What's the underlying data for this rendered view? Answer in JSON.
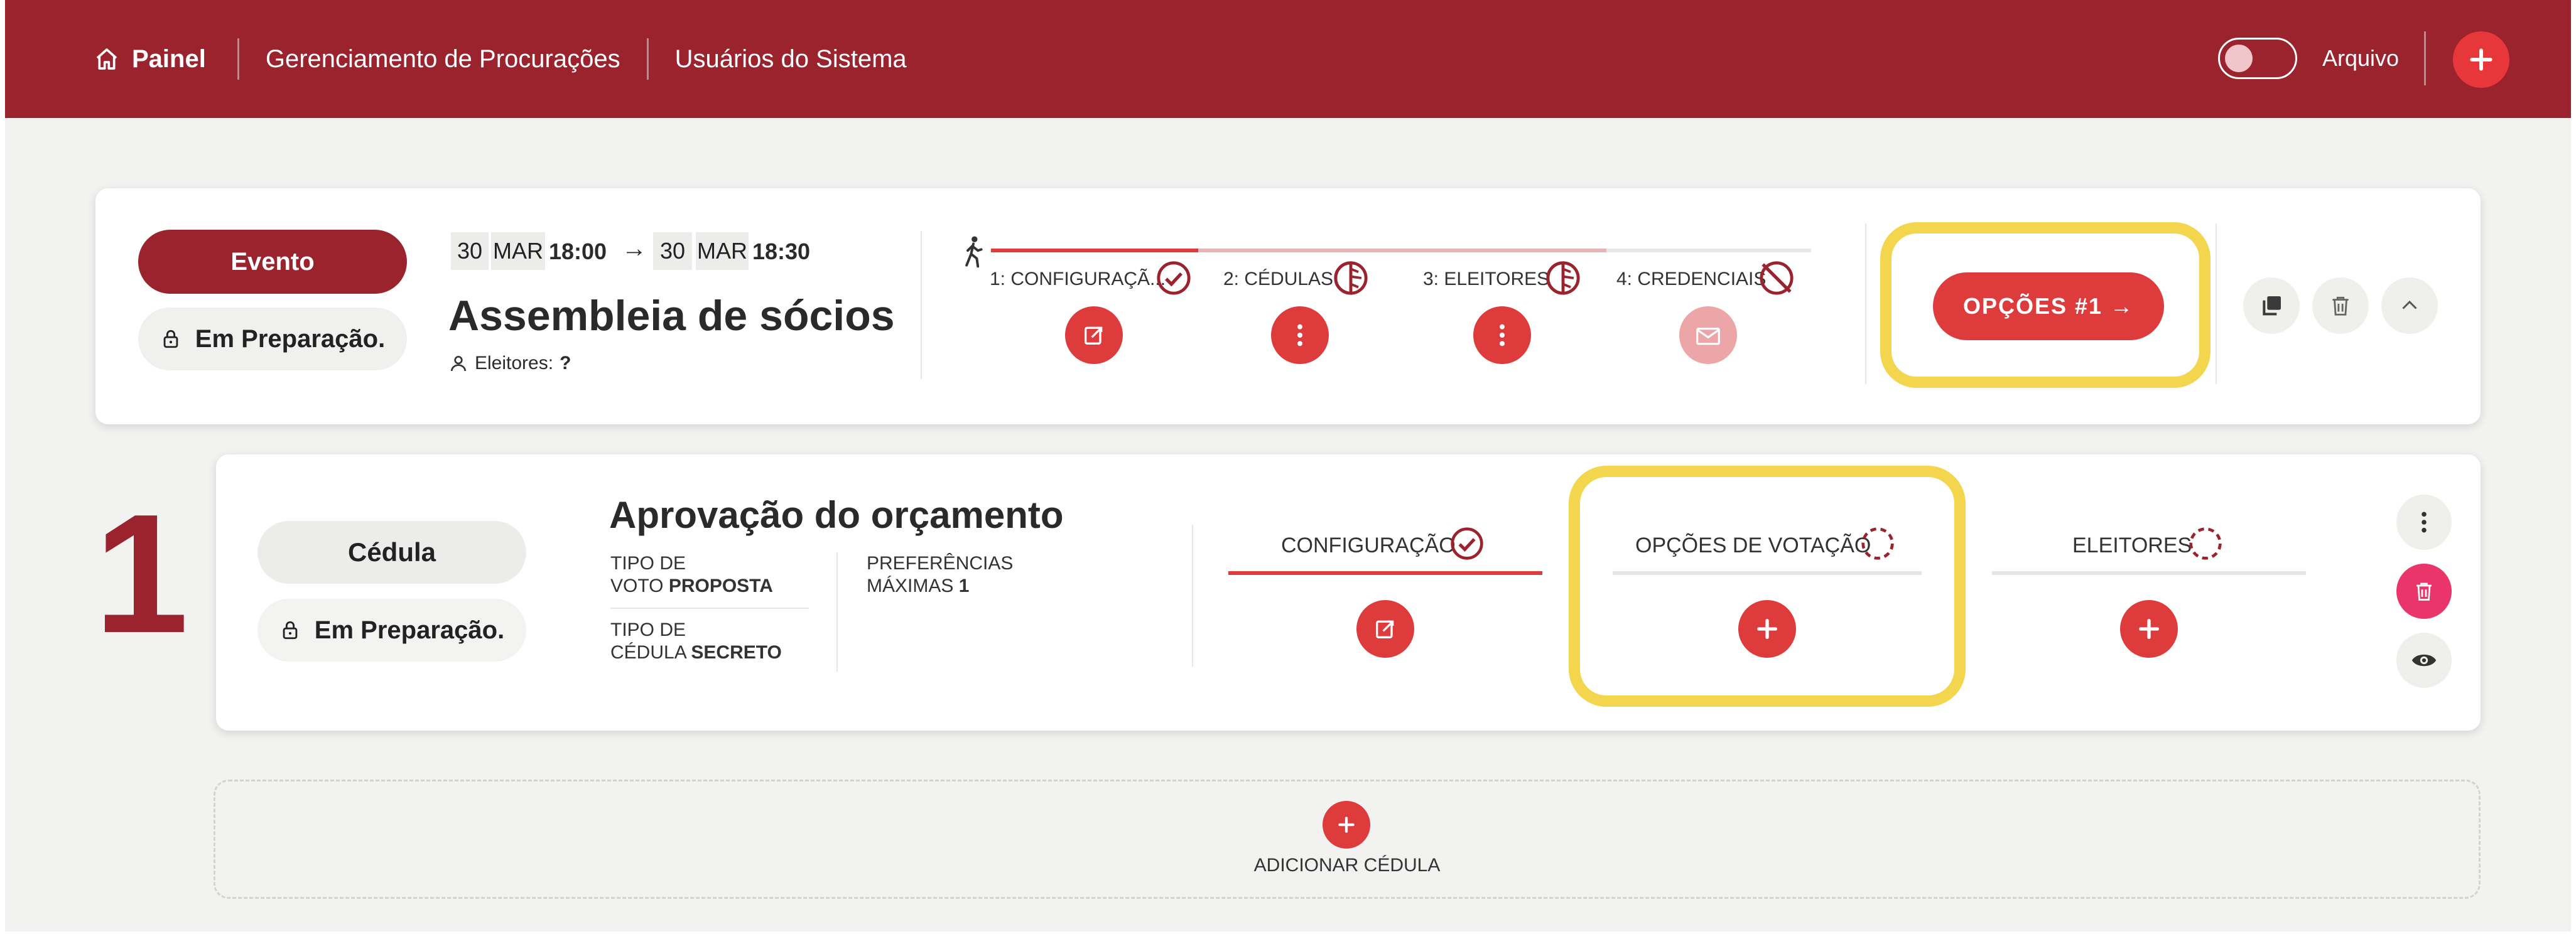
{
  "nav": {
    "home_label": "Painel",
    "proxy_label": "Gerenciamento de Procurações",
    "users_label": "Usuários do Sistema",
    "archive_label": "Arquivo"
  },
  "event": {
    "badge": "Evento",
    "status": "Em Preparação.",
    "start_day": "30",
    "start_month": "MAR",
    "start_time": "18:00",
    "end_day": "30",
    "end_month": "MAR",
    "end_time": "18:30",
    "arrow": "→",
    "title": "Assembleia de sócios",
    "voters_label": "Eleitores:",
    "voters_value": "?",
    "steps": [
      {
        "label": "1: CONFIGURAÇÃ...",
        "status_icon": "check-circle-icon"
      },
      {
        "label": "2: CÉDULAS",
        "status_icon": "half-circle-icon"
      },
      {
        "label": "3: ELEITORES",
        "status_icon": "half-circle-icon"
      },
      {
        "label": "4: CREDENCIAIS",
        "status_icon": "disabled-circle-icon"
      }
    ],
    "options_button": "OPÇÕES #1 →"
  },
  "ballot": {
    "number": "1",
    "badge": "Cédula",
    "status": "Em Preparação.",
    "title": "Aprovação do orçamento",
    "vote_type_label_1": "TIPO DE",
    "vote_type_label_2": "VOTO",
    "vote_type_value": "PROPOSTA",
    "ballot_type_label_1": "TIPO DE",
    "ballot_type_label_2": "CÉDULA",
    "ballot_type_value": "SECRETO",
    "prefs_label_1": "PREFERÊNCIAS",
    "prefs_label_2": "MÁXIMAS",
    "prefs_value": "1",
    "sections": [
      {
        "label": "CONFIGURAÇÃO",
        "status_icon": "check-circle-icon"
      },
      {
        "label": "OPÇÕES DE VOTAÇÃO",
        "status_icon": "dashed-circle-icon"
      },
      {
        "label": "ELEITORES",
        "status_icon": "dashed-circle-icon"
      }
    ]
  },
  "add_ballot": {
    "label": "ADICIONAR CÉDULA"
  },
  "colors": {
    "brand": "#9a232d",
    "accent": "#dd3b3c",
    "highlight": "#f4d54e",
    "pink": "#e9356a"
  }
}
